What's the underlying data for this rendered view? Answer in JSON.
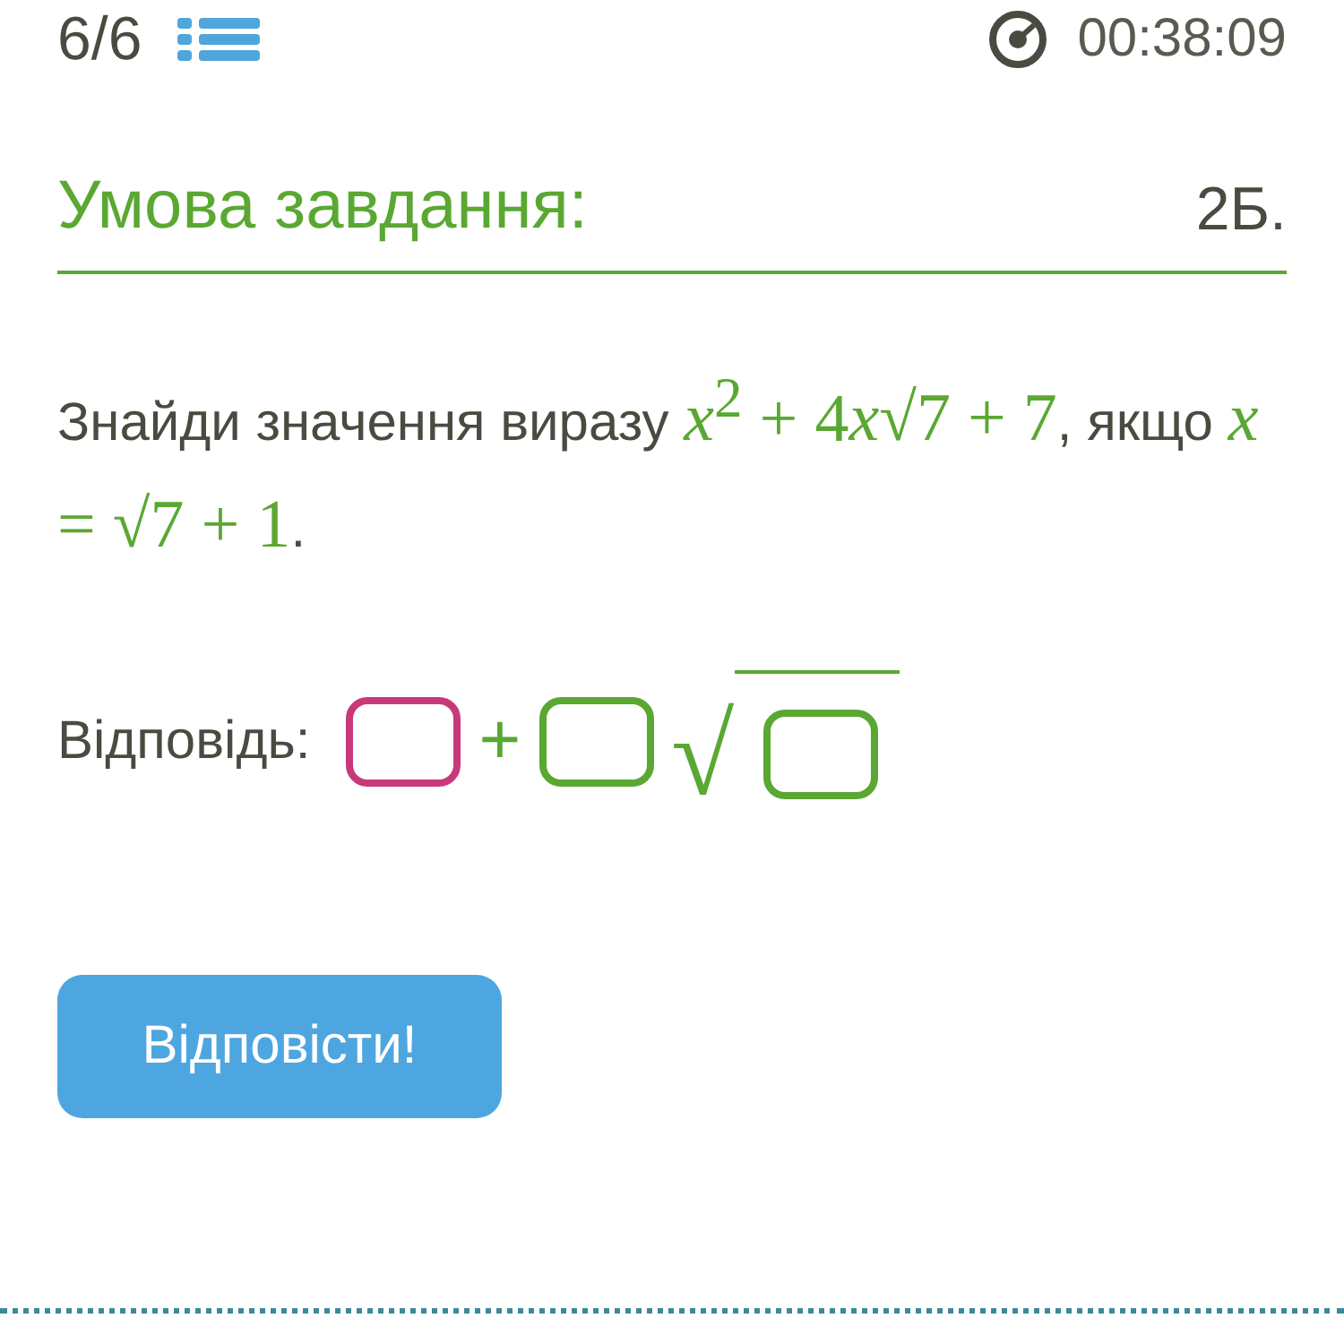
{
  "header": {
    "progress": "6/6",
    "timer": "00:38:09"
  },
  "task": {
    "title": "Умова завдання:",
    "points": "2Б."
  },
  "question": [
    {
      "kind": "text",
      "text": "Знайди значення виразу "
    },
    {
      "kind": "var",
      "text": "x"
    },
    {
      "kind": "math",
      "text": "$^{2}$ + 4"
    },
    {
      "kind": "var",
      "text": "x"
    },
    {
      "kind": "math",
      "text": "√7 + 7"
    },
    {
      "kind": "text",
      "text": ", якщо "
    },
    {
      "kind": "var",
      "text": "x"
    },
    {
      "kind": "math",
      "text": " = √7 + 1"
    },
    {
      "kind": "text",
      "text": "."
    }
  ],
  "answer": {
    "label": "Відповідь:",
    "fields": [
      {
        "kind": "box",
        "selected": true
      },
      {
        "kind": "plus",
        "text": "+"
      },
      {
        "kind": "box",
        "selected": false
      },
      {
        "kind": "root",
        "text": "√",
        "selected": false
      }
    ]
  },
  "submit": "Відповісти!"
}
